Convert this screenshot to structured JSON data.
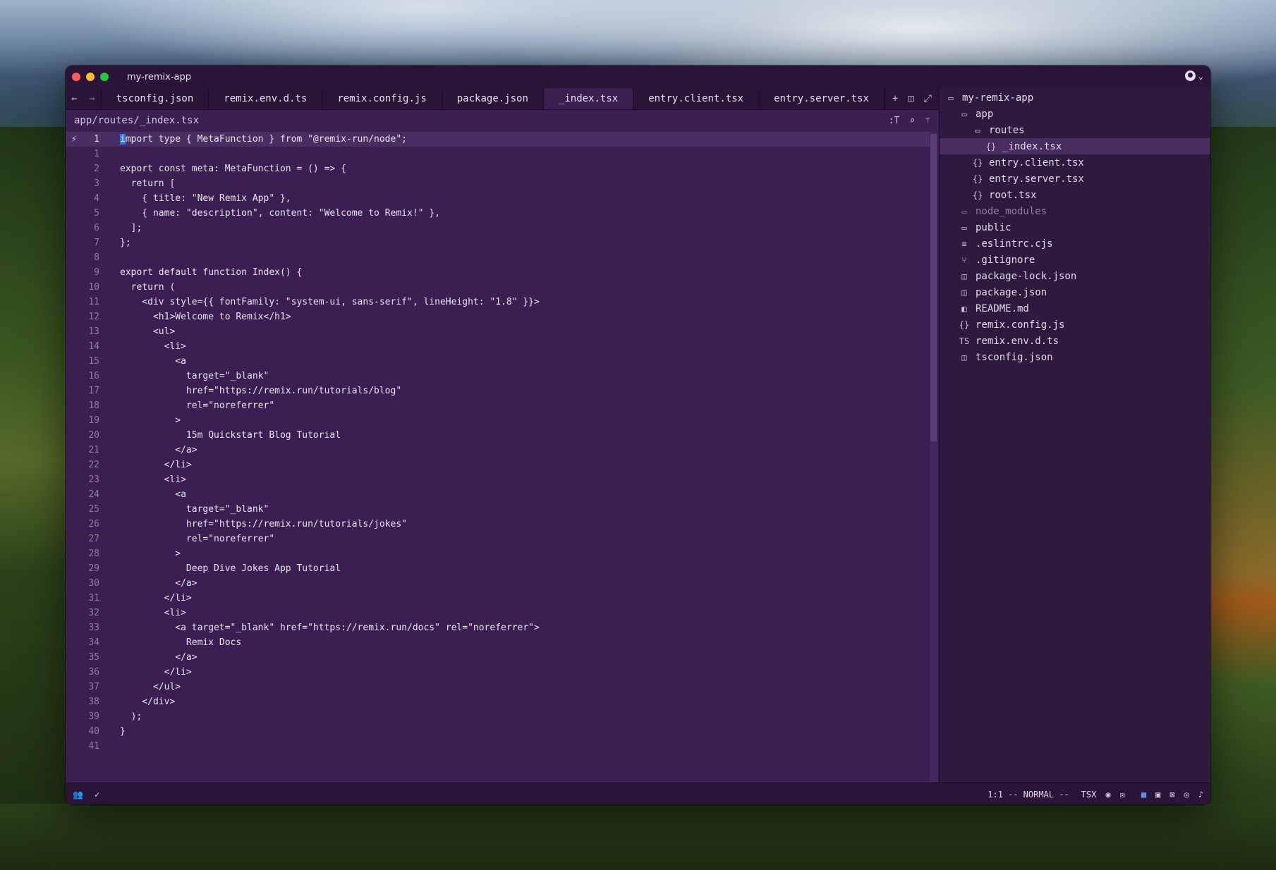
{
  "window": {
    "title": "my-remix-app"
  },
  "tabs": [
    {
      "label": "tsconfig.json",
      "active": false
    },
    {
      "label": "remix.env.d.ts",
      "active": false
    },
    {
      "label": "remix.config.js",
      "active": false
    },
    {
      "label": "package.json",
      "active": false
    },
    {
      "label": "_index.tsx",
      "active": true
    },
    {
      "label": "entry.client.tsx",
      "active": false
    },
    {
      "label": "entry.server.tsx",
      "active": false
    }
  ],
  "nav": {
    "back_icon": "arrow-left-icon",
    "forward_icon": "arrow-right-icon"
  },
  "tab_actions": {
    "new_tab": "+",
    "split": "split-icon",
    "expand": "expand-icon"
  },
  "breadcrumb": "app/routes/_index.tsx",
  "breadcrumb_actions": {
    "symbol": ":T",
    "search": "search-icon",
    "assist": "magic-wand-icon"
  },
  "editor": {
    "lines": [
      {
        "n": "1",
        "text": "import type { MetaFunction } from \"@remix-run/node\";"
      },
      {
        "n": "1",
        "text": ""
      },
      {
        "n": "2",
        "text": "export const meta: MetaFunction = () => {"
      },
      {
        "n": "3",
        "text": "  return ["
      },
      {
        "n": "4",
        "text": "    { title: \"New Remix App\" },"
      },
      {
        "n": "5",
        "text": "    { name: \"description\", content: \"Welcome to Remix!\" },"
      },
      {
        "n": "6",
        "text": "  ];"
      },
      {
        "n": "7",
        "text": "};"
      },
      {
        "n": "8",
        "text": ""
      },
      {
        "n": "9",
        "text": "export default function Index() {"
      },
      {
        "n": "10",
        "text": "  return ("
      },
      {
        "n": "11",
        "text": "    <div style={{ fontFamily: \"system-ui, sans-serif\", lineHeight: \"1.8\" }}>"
      },
      {
        "n": "12",
        "text": "      <h1>Welcome to Remix</h1>"
      },
      {
        "n": "13",
        "text": "      <ul>"
      },
      {
        "n": "14",
        "text": "        <li>"
      },
      {
        "n": "15",
        "text": "          <a"
      },
      {
        "n": "16",
        "text": "            target=\"_blank\""
      },
      {
        "n": "17",
        "text": "            href=\"https://remix.run/tutorials/blog\""
      },
      {
        "n": "18",
        "text": "            rel=\"noreferrer\""
      },
      {
        "n": "19",
        "text": "          >"
      },
      {
        "n": "20",
        "text": "            15m Quickstart Blog Tutorial"
      },
      {
        "n": "21",
        "text": "          </a>"
      },
      {
        "n": "22",
        "text": "        </li>"
      },
      {
        "n": "23",
        "text": "        <li>"
      },
      {
        "n": "24",
        "text": "          <a"
      },
      {
        "n": "25",
        "text": "            target=\"_blank\""
      },
      {
        "n": "26",
        "text": "            href=\"https://remix.run/tutorials/jokes\""
      },
      {
        "n": "27",
        "text": "            rel=\"noreferrer\""
      },
      {
        "n": "28",
        "text": "          >"
      },
      {
        "n": "29",
        "text": "            Deep Dive Jokes App Tutorial"
      },
      {
        "n": "30",
        "text": "          </a>"
      },
      {
        "n": "31",
        "text": "        </li>"
      },
      {
        "n": "32",
        "text": "        <li>"
      },
      {
        "n": "33",
        "text": "          <a target=\"_blank\" href=\"https://remix.run/docs\" rel=\"noreferrer\">"
      },
      {
        "n": "34",
        "text": "            Remix Docs"
      },
      {
        "n": "35",
        "text": "          </a>"
      },
      {
        "n": "36",
        "text": "        </li>"
      },
      {
        "n": "37",
        "text": "      </ul>"
      },
      {
        "n": "38",
        "text": "    </div>"
      },
      {
        "n": "39",
        "text": "  );"
      },
      {
        "n": "40",
        "text": "}"
      },
      {
        "n": "41",
        "text": ""
      }
    ]
  },
  "file_tree": [
    {
      "label": "my-remix-app",
      "icon": "folder-open-icon",
      "glyph": "▭",
      "depth": 0
    },
    {
      "label": "app",
      "icon": "folder-open-icon",
      "glyph": "▭",
      "depth": 1
    },
    {
      "label": "routes",
      "icon": "folder-open-icon",
      "glyph": "▭",
      "depth": 2
    },
    {
      "label": "_index.tsx",
      "icon": "braces-icon",
      "glyph": "{}",
      "depth": 3,
      "selected": true
    },
    {
      "label": "entry.client.tsx",
      "icon": "braces-icon",
      "glyph": "{}",
      "depth": 2
    },
    {
      "label": "entry.server.tsx",
      "icon": "braces-icon",
      "glyph": "{}",
      "depth": 2
    },
    {
      "label": "root.tsx",
      "icon": "braces-icon",
      "glyph": "{}",
      "depth": 2
    },
    {
      "label": "node_modules",
      "icon": "folder-icon",
      "glyph": "▭",
      "depth": 1,
      "dim": true
    },
    {
      "label": "public",
      "icon": "folder-icon",
      "glyph": "▭",
      "depth": 1
    },
    {
      "label": ".eslintrc.cjs",
      "icon": "lines-icon",
      "glyph": "≡",
      "depth": 1
    },
    {
      "label": ".gitignore",
      "icon": "git-branch-icon",
      "glyph": "⑂",
      "depth": 1
    },
    {
      "label": "package-lock.json",
      "icon": "database-icon",
      "glyph": "◫",
      "depth": 1
    },
    {
      "label": "package.json",
      "icon": "database-icon",
      "glyph": "◫",
      "depth": 1
    },
    {
      "label": "README.md",
      "icon": "book-icon",
      "glyph": "◧",
      "depth": 1
    },
    {
      "label": "remix.config.js",
      "icon": "braces-icon",
      "glyph": "{}",
      "depth": 1
    },
    {
      "label": "remix.env.d.ts",
      "icon": "typescript-icon",
      "glyph": "TS",
      "depth": 1
    },
    {
      "label": "tsconfig.json",
      "icon": "database-icon",
      "glyph": "◫",
      "depth": 1
    }
  ],
  "status": {
    "position": "1:1",
    "mode": "-- NORMAL --",
    "language": "TSX"
  },
  "colors": {
    "editor_bg": "#3b1f52",
    "current_line": "#4a2d62",
    "cursor": "#2b7de9",
    "sidebar_bg": "#2e1a3f"
  }
}
